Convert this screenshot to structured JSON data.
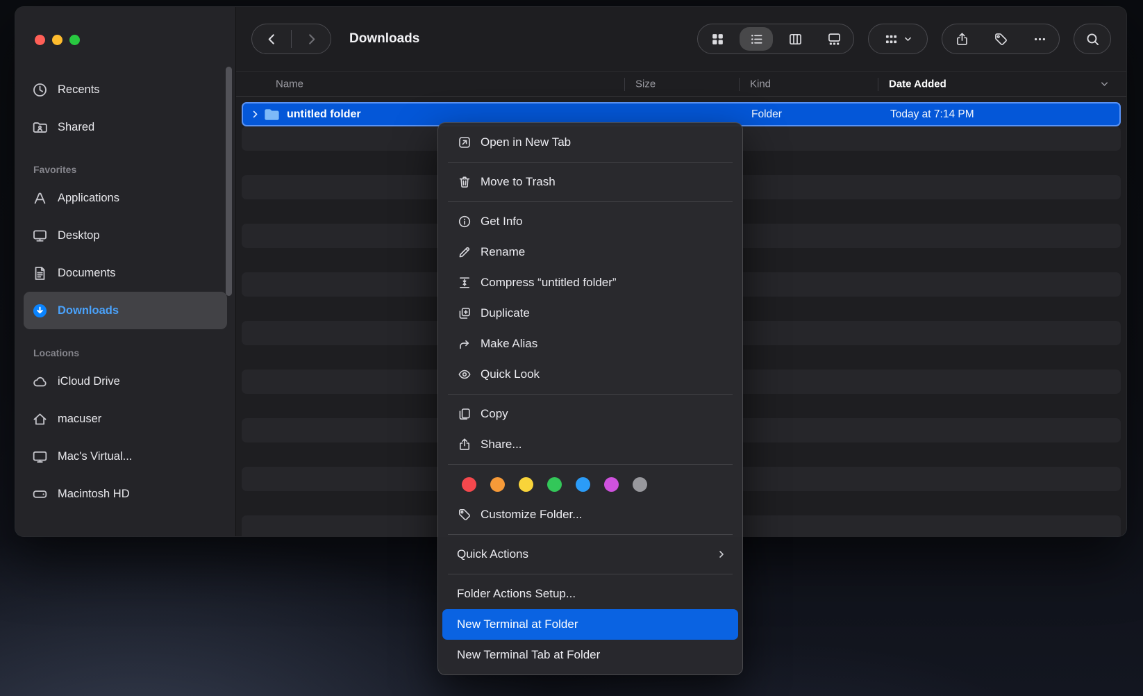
{
  "colors": {
    "accent": "#0a63e2",
    "row_selection": "#0457d8",
    "row_selection_border": "#5a93f5",
    "sidebar_accent": "#0a84ff",
    "traffic_close": "#ff5f57",
    "traffic_minimize": "#febc2e",
    "traffic_zoom": "#28c840"
  },
  "window": {
    "title": "Downloads"
  },
  "sidebar": {
    "recents": "Recents",
    "shared": "Shared",
    "favorites_header": "Favorites",
    "applications": "Applications",
    "desktop": "Desktop",
    "documents": "Documents",
    "downloads": "Downloads",
    "locations_header": "Locations",
    "icloud": "iCloud Drive",
    "home": "macuser",
    "virtual_machine": "Mac's Virtual...",
    "macintosh_hd": "Macintosh HD",
    "selected_item": "Downloads"
  },
  "toolbar": {
    "views": [
      "icons",
      "list",
      "columns",
      "gallery"
    ],
    "active_view": "list"
  },
  "list": {
    "columns": {
      "name": "Name",
      "size": "Size",
      "kind": "Kind",
      "date_added": "Date Added"
    },
    "sort_column": "Date Added",
    "selected_row": {
      "name": "untitled folder",
      "kind": "Folder",
      "date_added": "Today at 7:14 PM"
    }
  },
  "context_menu": {
    "open_in_new_tab": "Open in New Tab",
    "move_to_trash": "Move to Trash",
    "get_info": "Get Info",
    "rename": "Rename",
    "compress": "Compress “untitled folder”",
    "duplicate": "Duplicate",
    "make_alias": "Make Alias",
    "quick_look": "Quick Look",
    "copy": "Copy",
    "share": "Share...",
    "customize_folder": "Customize Folder...",
    "quick_actions": "Quick Actions",
    "folder_actions_setup": "Folder Actions Setup...",
    "new_terminal_at_folder": "New Terminal at Folder",
    "new_terminal_tab_at_folder": "New Terminal Tab at Folder",
    "highlighted_item": "New Terminal at Folder",
    "tags": [
      {
        "name": "red",
        "color": "#f5484d"
      },
      {
        "name": "orange",
        "color": "#f79a38"
      },
      {
        "name": "yellow",
        "color": "#f9d43a"
      },
      {
        "name": "green",
        "color": "#33c759"
      },
      {
        "name": "blue",
        "color": "#2b9cf8"
      },
      {
        "name": "purple",
        "color": "#cf52de"
      },
      {
        "name": "gray",
        "color": "#98989d"
      }
    ]
  }
}
